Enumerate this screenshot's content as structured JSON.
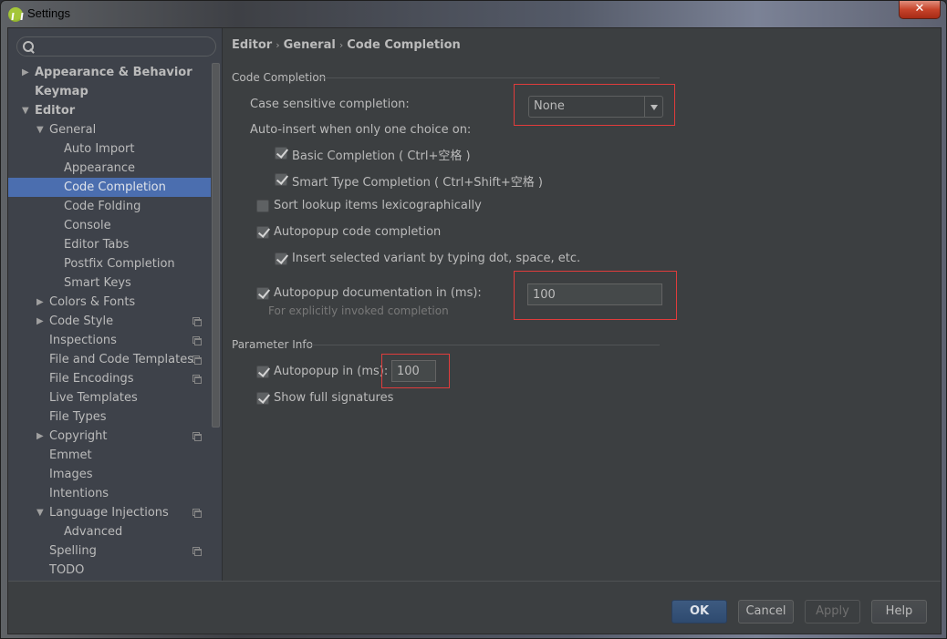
{
  "window": {
    "title": "Settings",
    "close_glyph": "✕"
  },
  "sidebar": {
    "search": {
      "value": "",
      "placeholder": ""
    },
    "items": [
      {
        "label": "Appearance & Behavior",
        "level": 0,
        "arrow": "▶",
        "bold": true
      },
      {
        "label": "Keymap",
        "level": 0,
        "arrow": "",
        "bold": true
      },
      {
        "label": "Editor",
        "level": 0,
        "arrow": "▼",
        "bold": true
      },
      {
        "label": "General",
        "level": 1,
        "arrow": "▼"
      },
      {
        "label": "Auto Import",
        "level": 2,
        "arrow": ""
      },
      {
        "label": "Appearance",
        "level": 2,
        "arrow": ""
      },
      {
        "label": "Code Completion",
        "level": 2,
        "arrow": "",
        "selected": true
      },
      {
        "label": "Code Folding",
        "level": 2,
        "arrow": ""
      },
      {
        "label": "Console",
        "level": 2,
        "arrow": ""
      },
      {
        "label": "Editor Tabs",
        "level": 2,
        "arrow": ""
      },
      {
        "label": "Postfix Completion",
        "level": 2,
        "arrow": ""
      },
      {
        "label": "Smart Keys",
        "level": 2,
        "arrow": ""
      },
      {
        "label": "Colors & Fonts",
        "level": 1,
        "arrow": "▶"
      },
      {
        "label": "Code Style",
        "level": 1,
        "arrow": "▶",
        "project_icon": true
      },
      {
        "label": "Inspections",
        "level": 1,
        "arrow": "",
        "project_icon": true
      },
      {
        "label": "File and Code Templates",
        "level": 1,
        "arrow": "",
        "project_icon": true
      },
      {
        "label": "File Encodings",
        "level": 1,
        "arrow": "",
        "project_icon": true
      },
      {
        "label": "Live Templates",
        "level": 1,
        "arrow": ""
      },
      {
        "label": "File Types",
        "level": 1,
        "arrow": ""
      },
      {
        "label": "Copyright",
        "level": 1,
        "arrow": "▶",
        "project_icon": true
      },
      {
        "label": "Emmet",
        "level": 1,
        "arrow": ""
      },
      {
        "label": "Images",
        "level": 1,
        "arrow": ""
      },
      {
        "label": "Intentions",
        "level": 1,
        "arrow": ""
      },
      {
        "label": "Language Injections",
        "level": 1,
        "arrow": "▼",
        "project_icon": true
      },
      {
        "label": "Advanced",
        "level": 2,
        "arrow": ""
      },
      {
        "label": "Spelling",
        "level": 1,
        "arrow": "",
        "project_icon": true
      },
      {
        "label": "TODO",
        "level": 1,
        "arrow": ""
      }
    ]
  },
  "breadcrumb": [
    "Editor",
    "General",
    "Code Completion"
  ],
  "breadcrumb_separator": "›",
  "code_completion": {
    "group_title": "Code Completion",
    "case_sensitive_label": "Case sensitive completion:",
    "case_sensitive_value": "None",
    "auto_insert_label": "Auto-insert when only one choice on:",
    "basic_completion": {
      "label": "Basic Completion ( Ctrl+空格 )",
      "checked": true
    },
    "smart_type_completion": {
      "label": "Smart Type Completion ( Ctrl+Shift+空格 )",
      "checked": true
    },
    "sort_lookup": {
      "label": "Sort lookup items lexicographically",
      "checked": false
    },
    "autopopup_code": {
      "label": "Autopopup code completion",
      "checked": true
    },
    "insert_selected": {
      "label": "Insert selected variant by typing dot, space, etc.",
      "checked": true
    },
    "autopopup_doc": {
      "label": "Autopopup documentation in (ms):",
      "checked": true,
      "value": "100"
    },
    "autopopup_doc_hint": "For explicitly invoked completion"
  },
  "parameter_info": {
    "group_title": "Parameter Info",
    "autopopup": {
      "label": "Autopopup in (ms):",
      "checked": true,
      "value": "100"
    },
    "show_full_signatures": {
      "label": "Show full signatures",
      "checked": true
    }
  },
  "footer": {
    "ok": "OK",
    "cancel": "Cancel",
    "apply": "Apply",
    "help": "Help"
  },
  "colors": {
    "selection": "#4b6eaf",
    "highlight_box": "#e03c3c",
    "panel_bg": "#3c3f41",
    "sidebar_bg": "#3e424a"
  }
}
